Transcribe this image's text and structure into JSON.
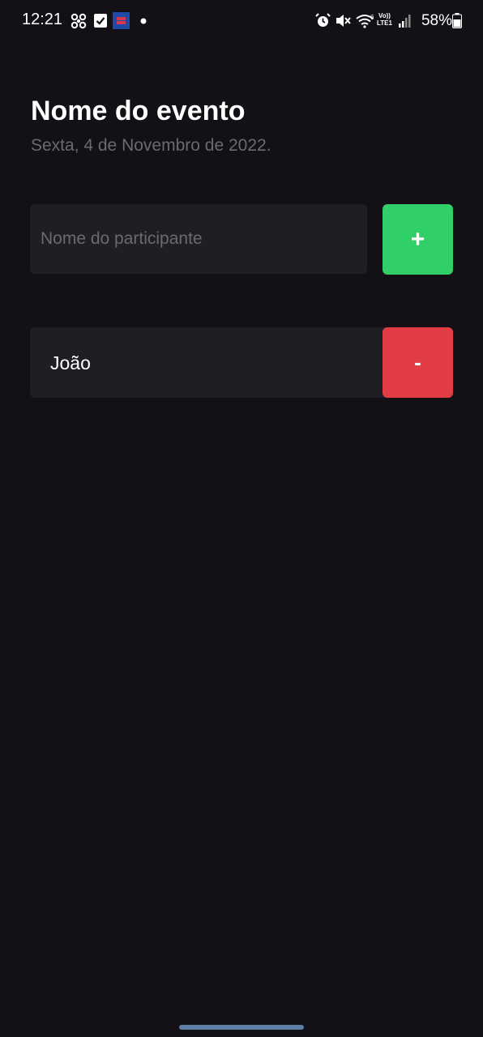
{
  "status_bar": {
    "time": "12:21",
    "battery": "58%",
    "network_label_top": "Vo))",
    "network_label_bottom": "LTE1",
    "icons": [
      "fan-icon",
      "checkbox-icon",
      "calendar-app-icon",
      "dot-icon",
      "alarm-icon",
      "mute-icon",
      "wifi-icon",
      "signal-icon",
      "battery-icon"
    ]
  },
  "header": {
    "title": "Nome do evento",
    "date": "Sexta, 4 de Novembro de 2022."
  },
  "form": {
    "placeholder": "Nome do participante",
    "add_label": "+"
  },
  "participants": [
    {
      "name": "João",
      "remove_label": "-"
    }
  ],
  "colors": {
    "background": "#131016",
    "surface": "#1f1e25",
    "add_button": "#31cf67",
    "remove_button": "#e23c44",
    "muted_text": "#6b6b6b"
  }
}
